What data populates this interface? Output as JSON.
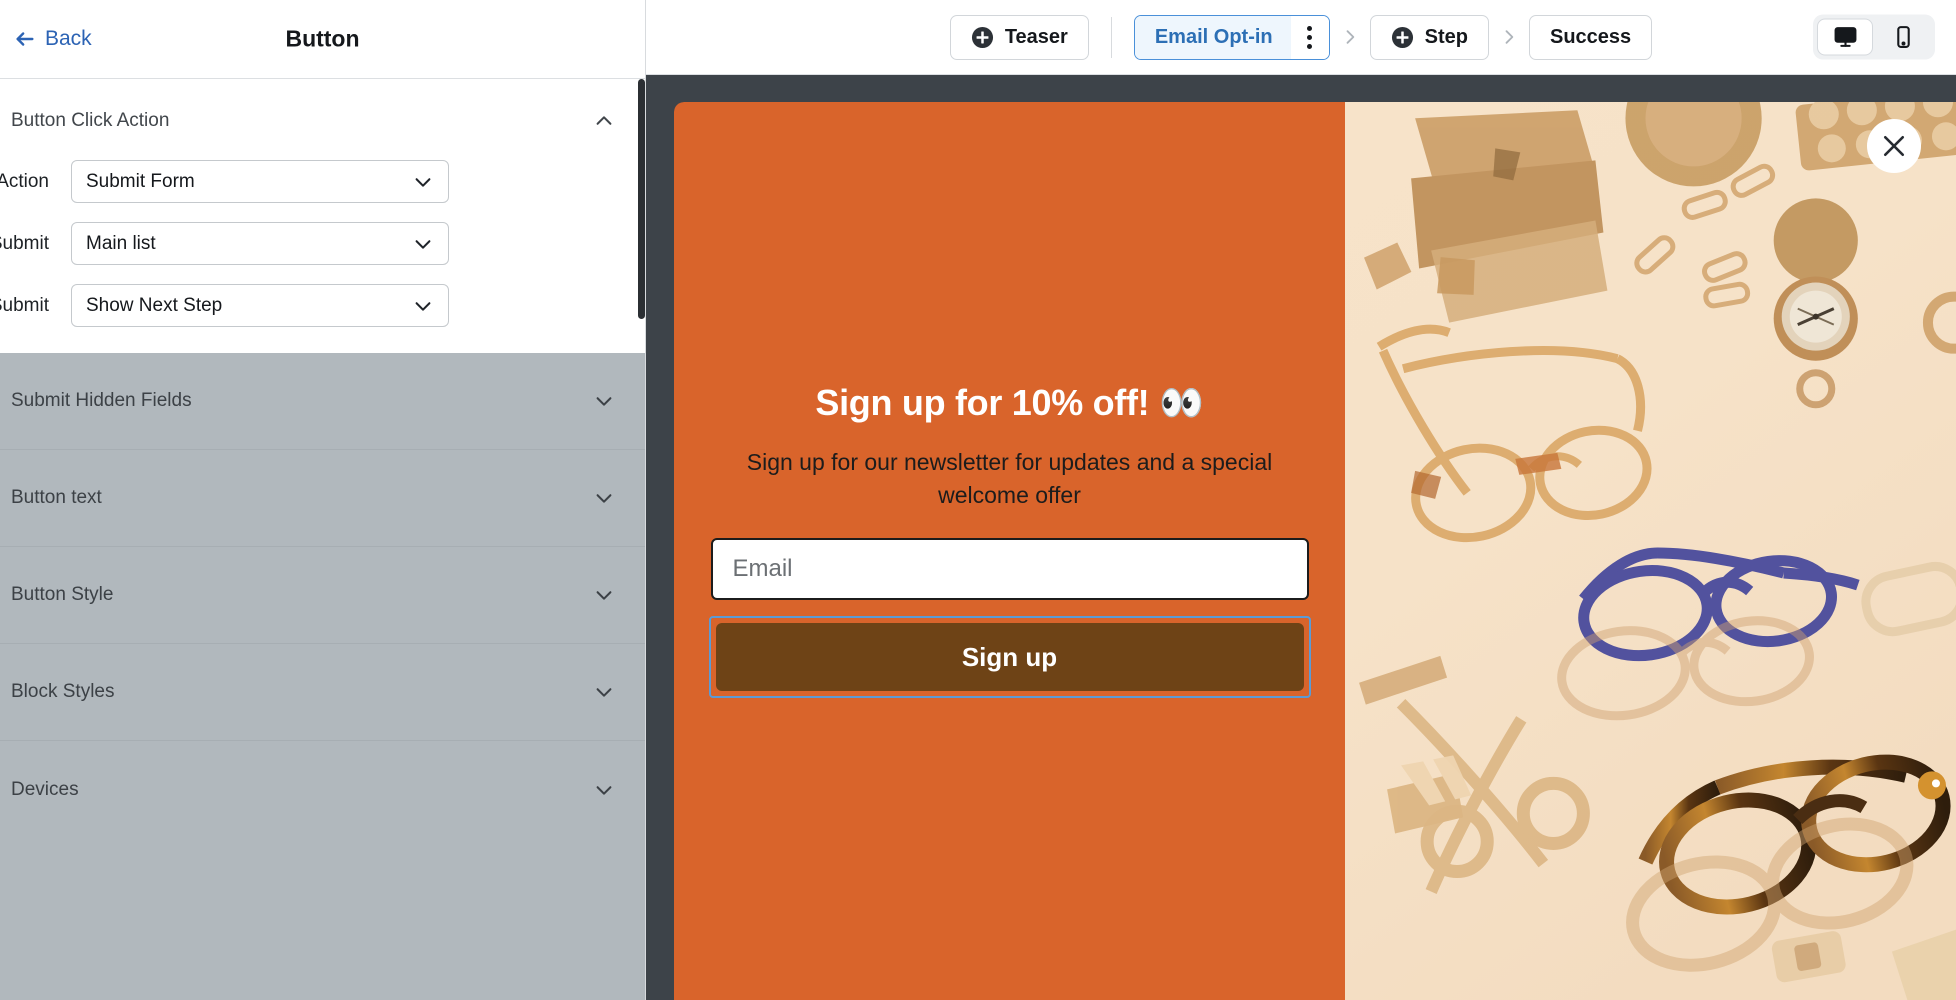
{
  "sidebar": {
    "back_label": "Back",
    "title": "Button",
    "open_section": {
      "title": "Button Click Action",
      "fields": [
        {
          "label": "Action",
          "value": "Submit Form"
        },
        {
          "label": "List to Submit",
          "value": "Main list"
        },
        {
          "label": "After Submit",
          "value": "Show Next Step"
        }
      ]
    },
    "collapsed_sections": [
      {
        "label": "Submit Hidden Fields"
      },
      {
        "label": "Button text"
      },
      {
        "label": "Button Style"
      },
      {
        "label": "Block Styles"
      },
      {
        "label": "Devices"
      }
    ]
  },
  "topbar": {
    "teaser_label": "Teaser",
    "active_step_label": "Email Opt-in",
    "add_step_label": "Step",
    "success_label": "Success",
    "devices": {
      "desktop": "desktop-monitor",
      "mobile": "mobile-phone",
      "selected": "desktop"
    }
  },
  "popup": {
    "headline": "Sign up for 10% off! 👀",
    "subheadline": "Sign up for our newsletter for updates and a special welcome offer",
    "email_placeholder": "Email",
    "submit_label": "Sign up",
    "close_icon": "close-x-icon",
    "colors": {
      "background": "#d9642b",
      "button": "#6e4316",
      "selection_outline": "#5b9bd5",
      "canvas": "#3d4349",
      "sidebar_collapsed": "#b1b8bd",
      "accent_blue": "#2c63b4"
    }
  }
}
